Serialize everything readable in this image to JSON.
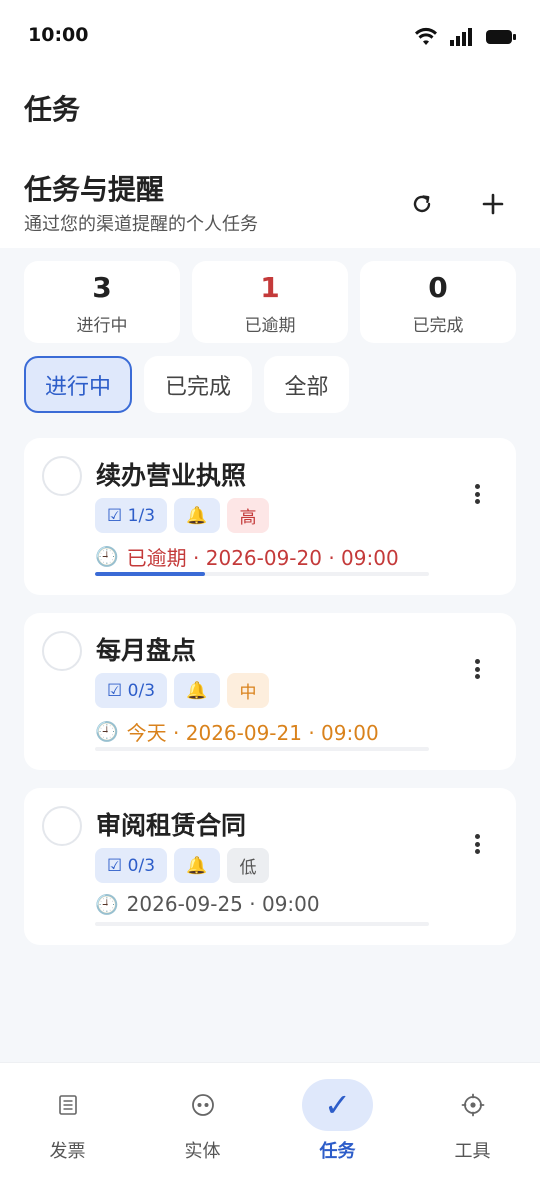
{
  "status_bar": {
    "time": "10:00"
  },
  "header": {
    "title": "任务"
  },
  "section": {
    "title": "任务与提醒",
    "subtitle": "通过您的渠道提醒的个人任务",
    "refresh_icon": "refresh-icon",
    "add_icon": "plus-icon"
  },
  "stats": [
    {
      "value": "3",
      "label": "进行中"
    },
    {
      "value": "1",
      "label": "已逾期"
    },
    {
      "value": "0",
      "label": "已完成"
    }
  ],
  "filters": [
    {
      "label": "进行中",
      "active": true
    },
    {
      "label": "已完成",
      "active": false
    },
    {
      "label": "全部",
      "active": false
    }
  ],
  "tasks": [
    {
      "title": "续办营业执照",
      "subtasks": "☑ 1/3",
      "priority": "高",
      "due": "已逾期 · 2026-09-20 · 09:00",
      "due_status": "overdue",
      "progress": 0.33
    },
    {
      "title": "每月盘点",
      "subtasks": "☑ 0/3",
      "priority": "中",
      "due": "今天 · 2026-09-21 · 09:00",
      "due_status": "today",
      "progress": 0
    },
    {
      "title": "审阅租赁合同",
      "subtasks": "☑ 0/3",
      "priority": "低",
      "due": "2026-09-25 · 09:00",
      "due_status": "normal",
      "progress": 0
    }
  ],
  "bottom_nav": [
    {
      "label": "发票",
      "icon": "invoice-icon",
      "active": false
    },
    {
      "label": "实体",
      "icon": "entity-icon",
      "active": false
    },
    {
      "label": "任务",
      "icon": "check-icon",
      "active": true
    },
    {
      "label": "工具",
      "icon": "gear-icon",
      "active": false
    }
  ],
  "colors": {
    "accent": "#3a6bd6",
    "overdue": "#c43a3a",
    "today": "#d9821c",
    "background": "#f5f7fa"
  }
}
